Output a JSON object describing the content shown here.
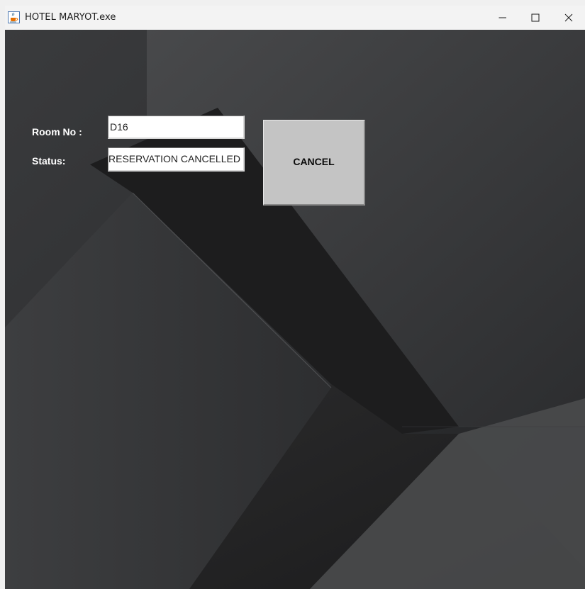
{
  "window": {
    "title": "HOTEL MARYOT.exe",
    "icon": "java-cup-icon",
    "controls": [
      "minimize-icon",
      "maximize-icon",
      "close-icon"
    ]
  },
  "form": {
    "room_label": "Room No :",
    "room_value": "D16",
    "status_label": "Status:",
    "status_value": "RESERVATION CANCELLED",
    "cancel_label": "CANCEL"
  },
  "colors": {
    "background": "#2b2c2e",
    "button": "#c4c4c4",
    "label_text": "#ffffff"
  }
}
